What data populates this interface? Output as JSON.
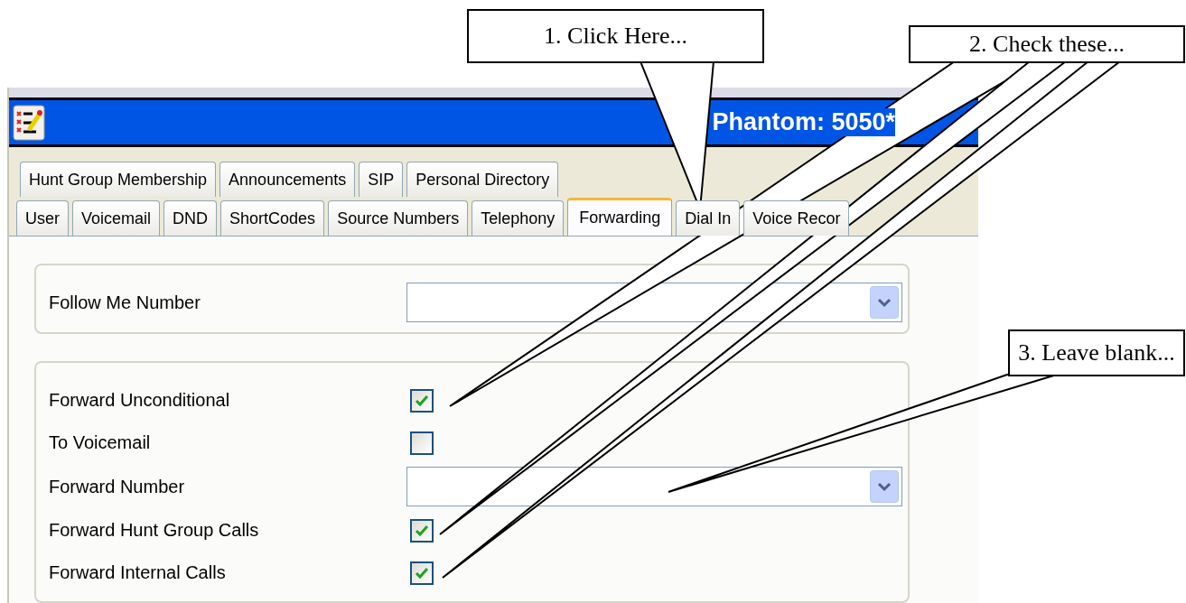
{
  "window": {
    "title": "Phantom: 5050*"
  },
  "tab_rows": [
    {
      "tabs": [
        {
          "label": "Hunt Group Membership",
          "selected": false
        },
        {
          "label": "Announcements",
          "selected": false
        },
        {
          "label": "SIP",
          "selected": false
        },
        {
          "label": "Personal Directory",
          "selected": false
        }
      ]
    },
    {
      "tabs": [
        {
          "label": "User",
          "selected": false
        },
        {
          "label": "Voicemail",
          "selected": false
        },
        {
          "label": "DND",
          "selected": false
        },
        {
          "label": "ShortCodes",
          "selected": false
        },
        {
          "label": "Source Numbers",
          "selected": false
        },
        {
          "label": "Telephony",
          "selected": false
        },
        {
          "label": "Forwarding",
          "selected": true
        },
        {
          "label": "Dial In",
          "selected": false
        },
        {
          "label": "Voice Recor",
          "selected": false
        }
      ]
    }
  ],
  "groups": [
    {
      "fields": [
        {
          "kind": "combo",
          "label": "Follow Me Number"
        }
      ]
    },
    {
      "fields": [
        {
          "kind": "checkbox",
          "label": "Forward Unconditional",
          "checked": true
        },
        {
          "kind": "checkbox",
          "label": "To Voicemail",
          "checked": false
        },
        {
          "kind": "combo",
          "label": "Forward Number"
        },
        {
          "kind": "checkbox",
          "label": "Forward Hunt Group Calls",
          "checked": true
        },
        {
          "kind": "checkbox",
          "label": "Forward Internal Calls",
          "checked": true
        }
      ]
    }
  ],
  "callouts": [
    {
      "text": "1. Click Here..."
    },
    {
      "text": "2. Check these..."
    },
    {
      "text": "3. Leave blank..."
    }
  ]
}
